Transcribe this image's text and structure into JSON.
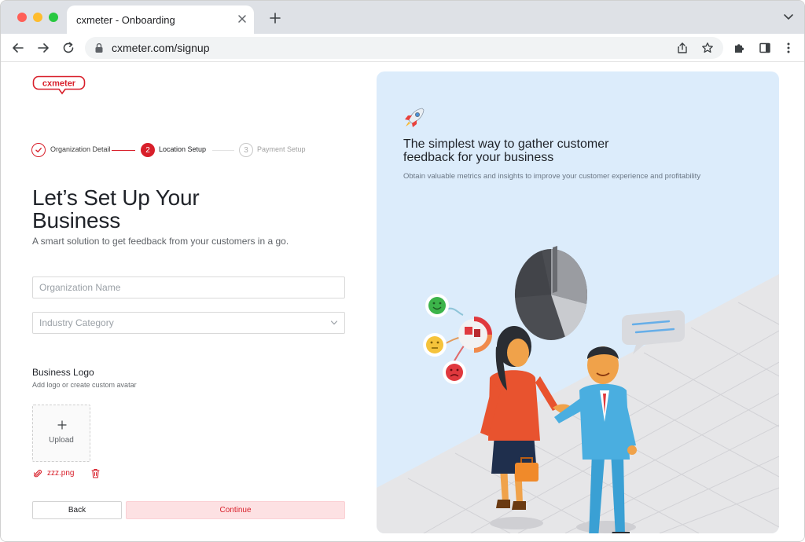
{
  "browser": {
    "tab_title": "cxmeter - Onboarding",
    "url": "cxmeter.com/signup"
  },
  "brand": {
    "logo_text": "cxmeter",
    "accent_color": "#d81f2a"
  },
  "stepper": {
    "steps": [
      {
        "number": "1",
        "label": "Organization Detail",
        "state": "completed"
      },
      {
        "number": "2",
        "label": "Location Setup",
        "state": "active"
      },
      {
        "number": "3",
        "label": "Payment Setup",
        "state": "pending"
      }
    ]
  },
  "form": {
    "heading_line1": "Let’s Set Up Your",
    "heading_line2": "Business",
    "subheading": "A smart solution to get feedback from your customers in a go.",
    "organization_name": {
      "value": "",
      "placeholder": "Organization Name"
    },
    "industry_category": {
      "value": "",
      "placeholder": "Industry Category"
    },
    "business_logo": {
      "title": "Business Logo",
      "help": "Add logo or create custom avatar",
      "upload_label": "Upload",
      "file_name": "zzz.png"
    },
    "back_label": "Back",
    "continue_label": "Continue"
  },
  "panel": {
    "title_line1": "The simplest way to gather customer",
    "title_line2": "feedback for your business",
    "subtitle": "Obtain valuable metrics and insights to improve your customer experience and profitability",
    "background_color": "#dcecfb"
  },
  "icons": {
    "back": "arrow-left-icon",
    "forward": "arrow-right-icon",
    "reload": "reload-icon",
    "lock": "lock-icon",
    "share": "share-icon",
    "bookmark": "star-icon",
    "extensions": "puzzle-icon",
    "side_panel": "side-panel-icon",
    "menu": "kebab-menu-icon",
    "attachment": "paperclip-icon",
    "delete": "trash-icon"
  }
}
